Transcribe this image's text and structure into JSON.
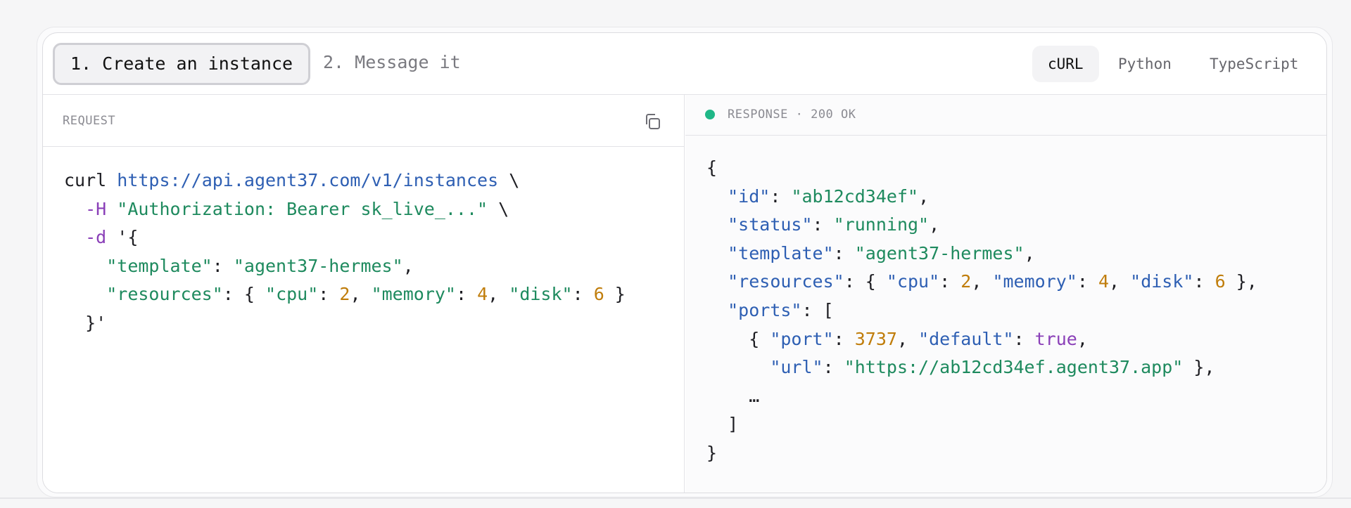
{
  "steps": [
    {
      "label": "1. Create an instance",
      "active": true
    },
    {
      "label": "2. Message it",
      "active": false
    }
  ],
  "languages": [
    {
      "label": "cURL",
      "active": true
    },
    {
      "label": "Python",
      "active": false
    },
    {
      "label": "TypeScript",
      "active": false
    }
  ],
  "request": {
    "label": "REQUEST",
    "copy_icon": "copy-icon",
    "code": {
      "cmd": "curl",
      "url": "https://api.agent37.com/v1/instances",
      "cont": "\\",
      "flag_h": "-H",
      "auth": "\"Authorization: Bearer sk_live_...\"",
      "flag_d": "-d",
      "open": "'{",
      "k_template": "\"template\"",
      "v_template": "\"agent37-hermes\"",
      "k_resources": "\"resources\"",
      "k_cpu": "\"cpu\"",
      "v_cpu": "2",
      "k_memory": "\"memory\"",
      "v_memory": "4",
      "k_disk": "\"disk\"",
      "v_disk": "6",
      "close": "}'"
    }
  },
  "response": {
    "label": "RESPONSE · 200 OK",
    "status_color": "#1fb787",
    "code": {
      "k_id": "\"id\"",
      "v_id": "\"ab12cd34ef\"",
      "k_status": "\"status\"",
      "v_status": "\"running\"",
      "k_template": "\"template\"",
      "v_template": "\"agent37-hermes\"",
      "k_resources": "\"resources\"",
      "k_cpu": "\"cpu\"",
      "v_cpu": "2",
      "k_memory": "\"memory\"",
      "v_memory": "4",
      "k_disk": "\"disk\"",
      "v_disk": "6",
      "k_ports": "\"ports\"",
      "k_port": "\"port\"",
      "v_port": "3737",
      "k_default": "\"default\"",
      "v_default": "true",
      "k_url": "\"url\"",
      "v_url": "\"https://ab12cd34ef.agent37.app\"",
      "ellipsis": "…"
    }
  }
}
